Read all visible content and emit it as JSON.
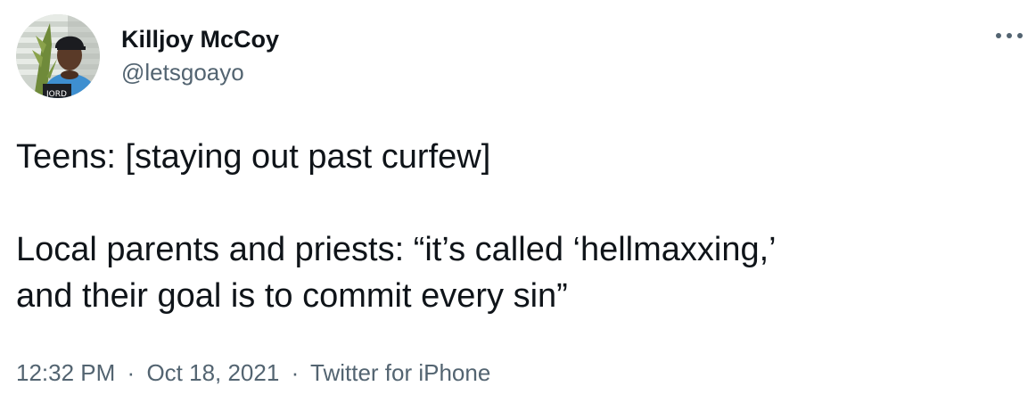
{
  "author": {
    "display_name": "Killjoy McCoy",
    "handle": "@letsgoayo"
  },
  "tweet": {
    "lines": [
      "Teens: [staying out past curfew]",
      "Local parents and priests: “it’s called ‘hellmaxxing,’",
      "and their goal is to commit every sin”"
    ]
  },
  "meta": {
    "time": "12:32 PM",
    "separator": "·",
    "date": "Oct 18, 2021",
    "source": "Twitter for iPhone"
  },
  "icons": {
    "more": "more-horizontal-icon",
    "avatar": "profile-photo"
  },
  "colors": {
    "text": "#0f1419",
    "secondary": "#536471",
    "background": "#ffffff"
  }
}
